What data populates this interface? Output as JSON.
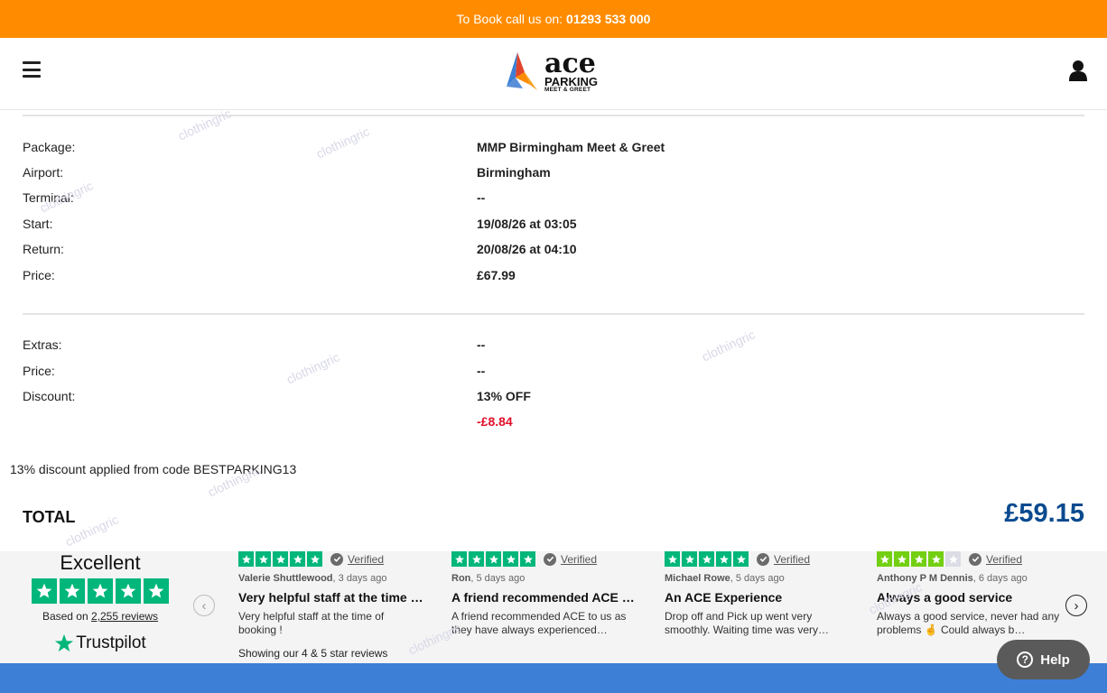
{
  "topbar": {
    "prefix": "To Book call us on:",
    "phone": "01293 533 000"
  },
  "header": {
    "logo": {
      "word": "ace",
      "line1": "PARKING",
      "line2": "MEET & GREET"
    },
    "brand_colors": {
      "orange": "#ff8c00",
      "blue": "#3d7fd6",
      "red": "#e0102a",
      "navy": "#0a4a8f"
    }
  },
  "booking": {
    "package_label": "Package:",
    "package_value": "MMP Birmingham Meet & Greet",
    "airport_label": "Airport:",
    "airport_value": "Birmingham",
    "terminal_label": "Terminal:",
    "terminal_value": "--",
    "start_label": "Start:",
    "start_value": "19/08/26 at 03:05",
    "return_label": "Return:",
    "return_value": "20/08/26 at 04:10",
    "price_label": "Price:",
    "price_value": "£67.99"
  },
  "extras": {
    "extras_label": "Extras:",
    "extras_value": "--",
    "price_label": "Price:",
    "price_value": "--",
    "discount_label": "Discount:",
    "discount_value": "13% OFF",
    "discount_amount": "-£8.84"
  },
  "code_note": "13% discount applied from code BESTPARKING13",
  "total": {
    "label": "TOTAL",
    "value": "£59.15"
  },
  "trustpilot": {
    "rating_word": "Excellent",
    "based_on": "Based on",
    "reviews_count": "2,255 reviews",
    "brand": "Trustpilot",
    "showing": "Showing our 4 & 5 star reviews",
    "verified_label": "Verified",
    "reviews": [
      {
        "author": "Valerie Shuttlewood",
        "when": ", 3 days ago",
        "stars": 5,
        "title": "Very helpful staff at the time of booking",
        "body": "Very helpful staff at the time of booking !"
      },
      {
        "author": "Ron",
        "when": ", 5 days ago",
        "stars": 5,
        "title": "A friend recommended ACE to us",
        "body": "A friend recommended ACE to us as they have always experienced…"
      },
      {
        "author": "Michael Rowe",
        "when": ", 5 days ago",
        "stars": 5,
        "title": "An ACE Experience",
        "body": "Drop off and Pick up went very smoothly. Waiting time was very…"
      },
      {
        "author": "Anthony P M Dennis",
        "when": ", 6 days ago",
        "stars": 4,
        "title": "Always a good service",
        "body": "Always a good service, never had any problems 🤞 Could always b…"
      }
    ]
  },
  "help": {
    "label": "Help"
  },
  "watermark": "clothingric"
}
